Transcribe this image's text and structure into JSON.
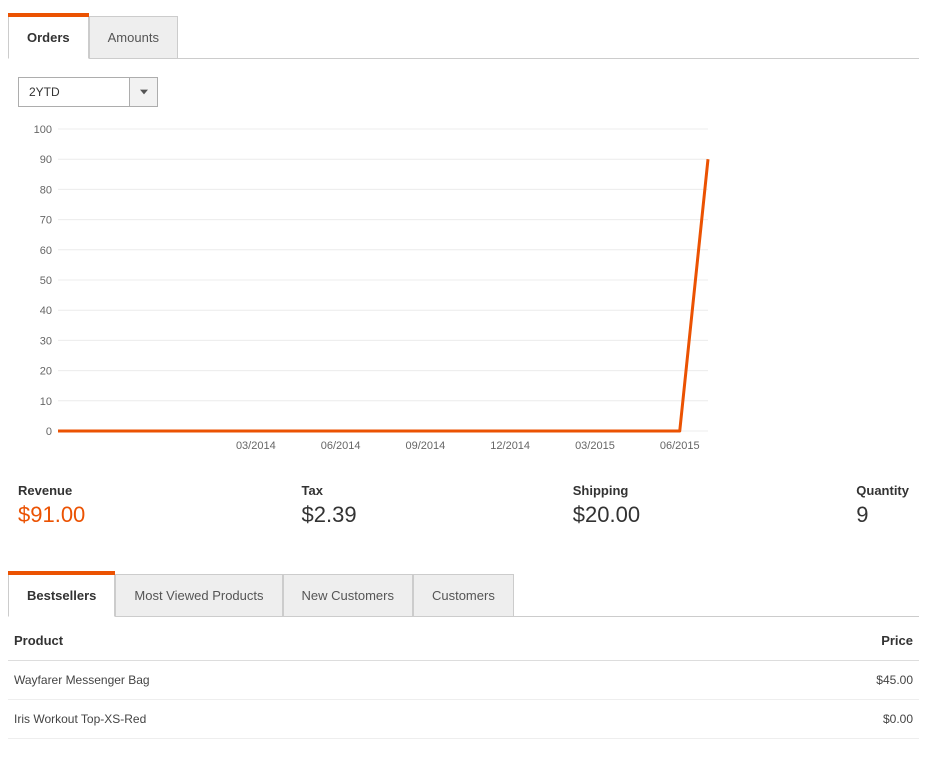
{
  "main_tabs": {
    "active": "Orders",
    "items": [
      "Orders",
      "Amounts"
    ]
  },
  "period_dropdown": {
    "selected": "2YTD"
  },
  "chart_data": {
    "type": "line",
    "xlabel": "",
    "ylabel": "",
    "ylim": [
      0,
      100
    ],
    "yticks": [
      0,
      10,
      20,
      30,
      40,
      50,
      60,
      70,
      80,
      90,
      100
    ],
    "xticks": [
      "03/2014",
      "06/2014",
      "09/2014",
      "12/2014",
      "03/2015",
      "06/2015"
    ],
    "x": [
      "08/2013",
      "09/2013",
      "10/2013",
      "11/2013",
      "12/2013",
      "01/2014",
      "02/2014",
      "03/2014",
      "04/2014",
      "05/2014",
      "06/2014",
      "07/2014",
      "08/2014",
      "09/2014",
      "10/2014",
      "11/2014",
      "12/2014",
      "01/2015",
      "02/2015",
      "03/2015",
      "04/2015",
      "05/2015",
      "06/2015",
      "07/2015"
    ],
    "values": [
      0,
      0,
      0,
      0,
      0,
      0,
      0,
      0,
      0,
      0,
      0,
      0,
      0,
      0,
      0,
      0,
      0,
      0,
      0,
      0,
      0,
      0,
      0,
      90
    ],
    "color": "#eb5202"
  },
  "summary": {
    "revenue": {
      "label": "Revenue",
      "value": "$91.00"
    },
    "tax": {
      "label": "Tax",
      "value": "$2.39"
    },
    "shipping": {
      "label": "Shipping",
      "value": "$20.00"
    },
    "quantity": {
      "label": "Quantity",
      "value": "9"
    }
  },
  "bottom_tabs": {
    "active": "Bestsellers",
    "items": [
      "Bestsellers",
      "Most Viewed Products",
      "New Customers",
      "Customers"
    ]
  },
  "table": {
    "columns": {
      "product": "Product",
      "price": "Price"
    },
    "rows": [
      {
        "product": "Wayfarer Messenger Bag",
        "price": "$45.00"
      },
      {
        "product": "Iris Workout Top-XS-Red",
        "price": "$0.00"
      }
    ]
  }
}
